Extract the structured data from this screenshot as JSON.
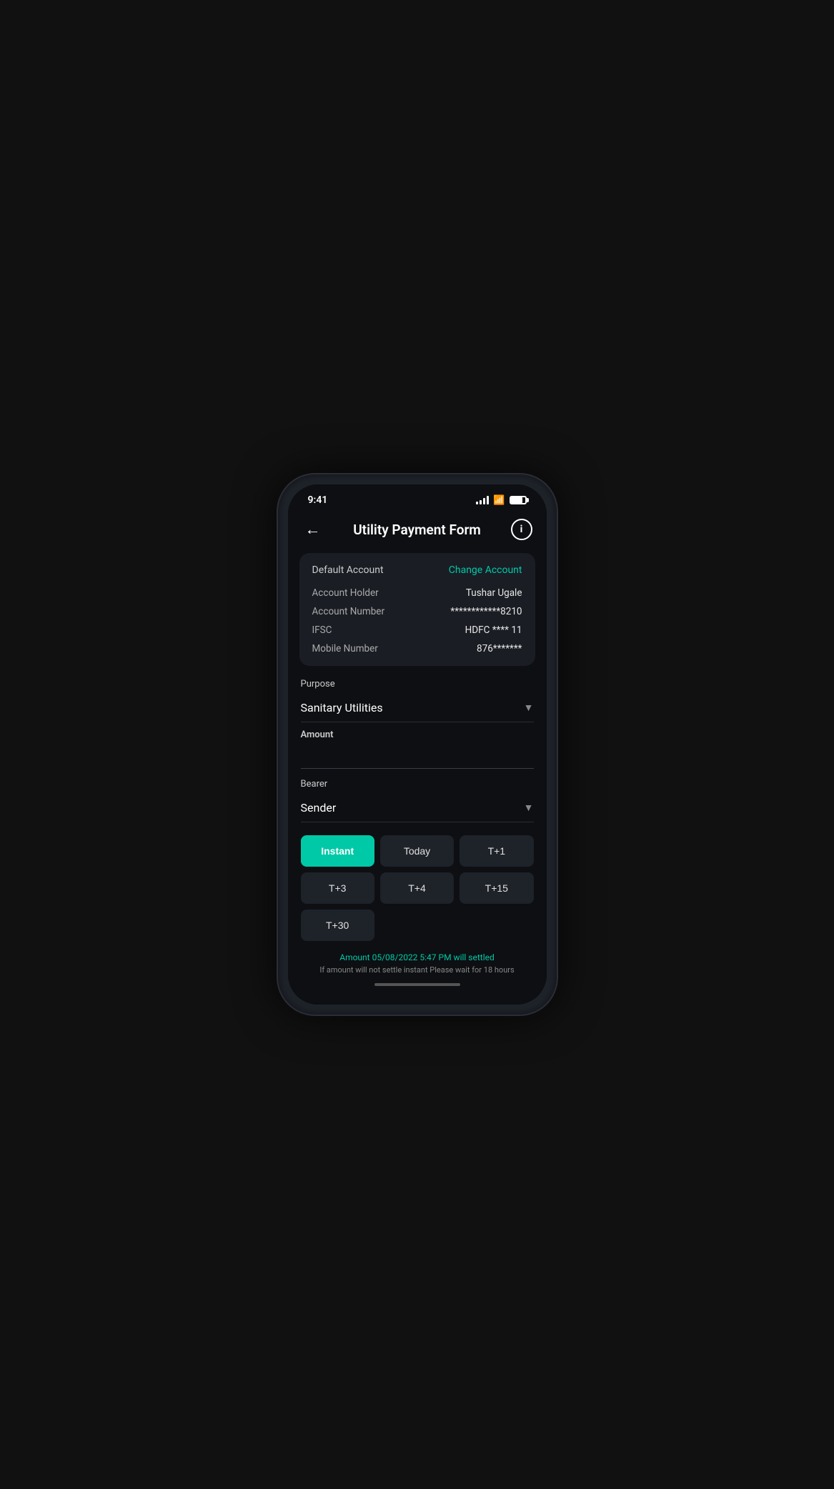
{
  "statusBar": {
    "time": "9:41",
    "battery": "80"
  },
  "header": {
    "title": "Utility Payment Form",
    "backLabel": "←",
    "infoLabel": "i"
  },
  "accountCard": {
    "defaultLabel": "Default Account",
    "changeAccountLink": "Change Account",
    "rows": [
      {
        "label": "Account Holder",
        "value": "Tushar Ugale"
      },
      {
        "label": "Account Number",
        "value": "************8210"
      },
      {
        "label": "IFSC",
        "value": "HDFC **** 11"
      },
      {
        "label": "Mobile Number",
        "value": "876*******"
      }
    ]
  },
  "purpose": {
    "label": "Purpose",
    "value": "Sanitary Utilities"
  },
  "amount": {
    "label": "Amount",
    "placeholder": ""
  },
  "bearer": {
    "label": "Bearer",
    "value": "Sender"
  },
  "timing": {
    "buttons": [
      {
        "label": "Instant",
        "active": true
      },
      {
        "label": "Today",
        "active": false
      },
      {
        "label": "T+1",
        "active": false
      },
      {
        "label": "T+3",
        "active": false
      },
      {
        "label": "T+4",
        "active": false
      },
      {
        "label": "T+15",
        "active": false
      },
      {
        "label": "T+30",
        "active": false
      }
    ]
  },
  "settledInfo": {
    "mainText": "Amount 05/08/2022 5:47 PM will settled",
    "subText": "If amount will not settle instant Please wait for 18 hours"
  }
}
